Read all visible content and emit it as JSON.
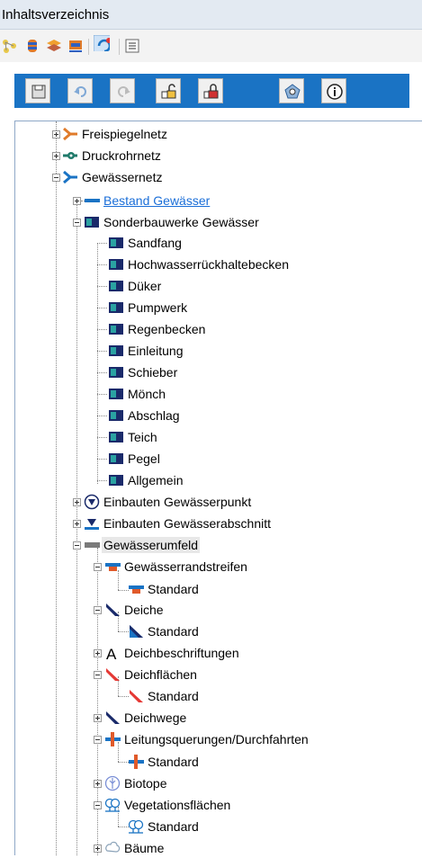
{
  "panel": {
    "title": "Inhaltsverzeichnis"
  },
  "colors": {
    "accent": "#1a73c4",
    "link": "#1a6ed8",
    "panel_header": "#e3eaf2"
  },
  "toolbar_top": {
    "icons": [
      "layers-tree-icon",
      "database-icon",
      "stack-layers-icon",
      "folder-layers-icon",
      "refresh-icon",
      "list-icon"
    ]
  },
  "toolbar_main": {
    "buttons": [
      "save-icon",
      "undo-icon",
      "redo-icon",
      "lock-open-icon",
      "lock-closed-icon",
      "search-zoom-icon",
      "info-icon"
    ]
  },
  "tree": {
    "freispiegelnetz": "Freispiegelnetz",
    "druckrohrnetz": "Druckrohrnetz",
    "gewaessernetz": "Gewässernetz",
    "bestand_gewaesser": "Bestand Gewässer",
    "sonderbauwerke": "Sonderbauwerke Gewässer",
    "sonder_items": [
      "Sandfang",
      "Hochwasserrückhaltebecken",
      "Düker",
      "Pumpwerk",
      "Regenbecken",
      "Einleitung",
      "Schieber",
      "Mönch",
      "Abschlag",
      "Teich",
      "Pegel",
      "Allgemein"
    ],
    "einbauten_punkt": "Einbauten Gewässerpunkt",
    "einbauten_abschnitt": "Einbauten Gewässerabschnitt",
    "gewaesserumfeld": "Gewässerumfeld",
    "randstreifen": "Gewässerrandstreifen",
    "randstreifen_std": "Standard",
    "deiche": "Deiche",
    "deiche_std": "Standard",
    "deichbeschriftungen": "Deichbeschriftungen",
    "deichflaechen": "Deichflächen",
    "deichflaechen_std": "Standard",
    "deichwege": "Deichwege",
    "leitungsquerungen": "Leitungsquerungen/Durchfahrten",
    "leitungsquerungen_std": "Standard",
    "biotope": "Biotope",
    "vegetationsflaechen": "Vegetationsflächen",
    "vegetationsflaechen_std": "Standard",
    "baeume": "Bäume"
  }
}
